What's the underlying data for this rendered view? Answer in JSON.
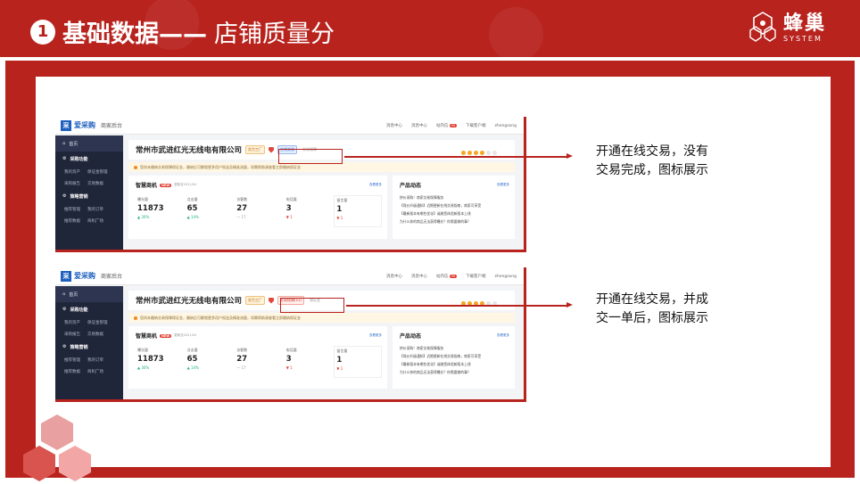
{
  "slide": {
    "number": "1",
    "title_bold": "基础数据——",
    "title_light": "店铺质量分",
    "brand_cn": "蜂巢",
    "brand_en": "SYSTEM"
  },
  "app": {
    "logo": "爱采购",
    "subtitle": "商家后台",
    "topnav": [
      "消息中心",
      "消息中心",
      "站内信",
      "下载客户端",
      "zhengsong"
    ],
    "unread_count": "99",
    "sidebar": {
      "home": "首页",
      "section1": "采购功能",
      "section1_items": [
        [
          "我的资产",
          "保证金管理"
        ],
        [
          "采购报告",
          "交易数据"
        ]
      ],
      "section2": "策略营销",
      "section2_items": [
        [
          "推荐管理",
          "我的订单"
        ],
        [
          "推荐数据",
          "商机广场"
        ]
      ]
    },
    "shop_name": "常州市武进红光无线电有限公司",
    "notice": "您尚未缴纳交易保障保证金，缴纳后可解锁更多用户权益及精准流量，如需帮助请查看立即缴纳保证金",
    "business_panel": {
      "title": "智慧商机",
      "badge": "NEW",
      "updated": "更新至2021/04",
      "more": "查看更多",
      "stats": [
        {
          "label": "曝光量",
          "value": "11873",
          "change": "▲ 30%",
          "trend": "up"
        },
        {
          "label": "点击量",
          "value": "65",
          "change": "▲ 14%",
          "trend": "up"
        },
        {
          "label": "访客数",
          "value": "27",
          "change": "— 17",
          "trend": "flat"
        },
        {
          "label": "电话量",
          "value": "3",
          "change": "▼ 1",
          "trend": "down"
        },
        {
          "label": "留言量",
          "value": "1",
          "change": "▼ 1",
          "trend": "down"
        }
      ]
    },
    "product_panel": {
      "title": "产品动态",
      "more": "查看更多",
      "lines": [
        "拼价采购！商家交易保障服务",
        "【保价升级通知】近期更新在线交易指南，商家可享受",
        "【最新版本有哪些优化】诚邀您体验新版本上线",
        "为什么你的商品无法获得曝光？你需要做的事？"
      ]
    }
  },
  "screens": [
    {
      "tags": {
        "verified": "实力工厂",
        "status": "在线交易",
        "extra": "交易保障"
      },
      "note": [
        "开通在线交易，没有",
        "交易完成，图标展示"
      ]
    },
    {
      "tags": {
        "verified": "实力工厂",
        "status": "交易保障(x1)",
        "extra": "保证金"
      },
      "note": [
        "开通在线交易，并成",
        "交一单后，图标展示"
      ]
    }
  ]
}
